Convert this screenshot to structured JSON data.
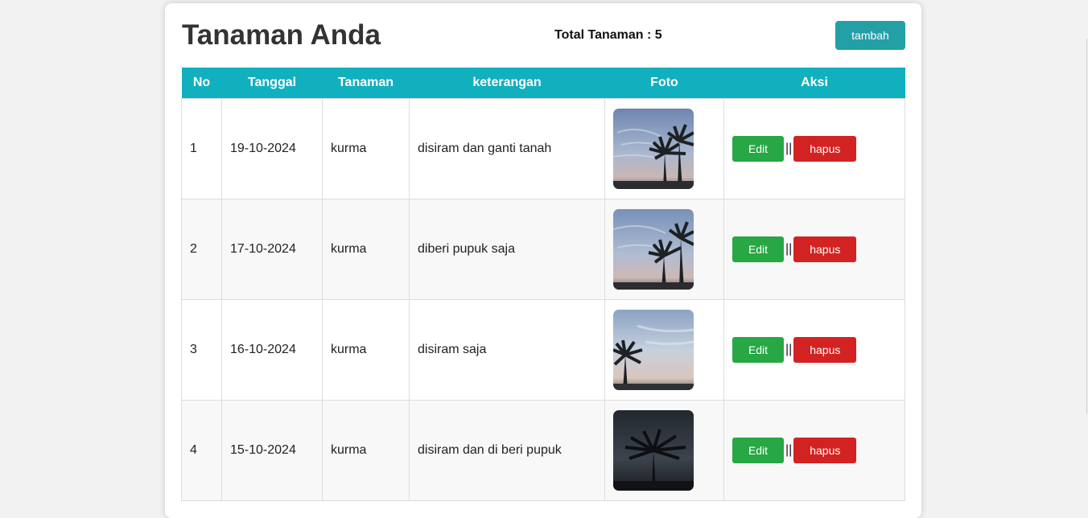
{
  "header": {
    "title": "Tanaman Anda",
    "total": "Total Tanaman : 5",
    "add_label": "tambah"
  },
  "table": {
    "columns": [
      "No",
      "Tanggal",
      "Tanaman",
      "keterangan",
      "Foto",
      "Aksi"
    ],
    "rows": [
      {
        "no": "1",
        "tanggal": "19-10-2024",
        "tanaman": "kurma",
        "keterangan": "disiram dan ganti tanah",
        "edit": "Edit",
        "sep": "||",
        "hapus": "hapus"
      },
      {
        "no": "2",
        "tanggal": "17-10-2024",
        "tanaman": "kurma",
        "keterangan": "diberi pupuk saja",
        "edit": "Edit",
        "sep": "||",
        "hapus": "hapus"
      },
      {
        "no": "3",
        "tanggal": "16-10-2024",
        "tanaman": "kurma",
        "keterangan": "disiram saja",
        "edit": "Edit",
        "sep": "||",
        "hapus": "hapus"
      },
      {
        "no": "4",
        "tanggal": "15-10-2024",
        "tanaman": "kurma",
        "keterangan": "disiram dan di beri pupuk",
        "edit": "Edit",
        "sep": "||",
        "hapus": "hapus"
      }
    ]
  },
  "colors": {
    "header_bg": "#11b0be",
    "add_button": "#22a0a6",
    "edit_button": "#28a745",
    "delete_button": "#d32222"
  }
}
